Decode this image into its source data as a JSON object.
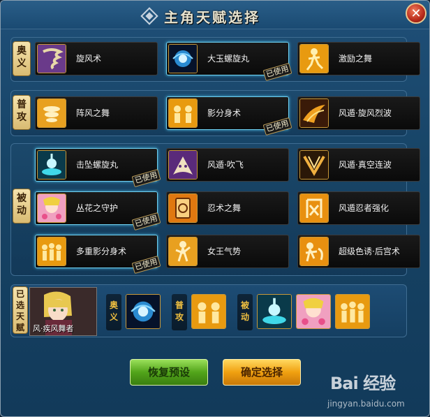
{
  "window": {
    "title": "主角天赋选择",
    "close_label": "✕"
  },
  "sections": {
    "ougi": {
      "tag": [
        "奥",
        "义"
      ],
      "skills": [
        {
          "name": "旋风术",
          "used": false,
          "icon": "tornado-icon"
        },
        {
          "name": "大玉螺旋丸",
          "used": true,
          "icon": "rasengan-icon"
        },
        {
          "name": "激励之舞",
          "used": false,
          "icon": "dance-icon"
        }
      ]
    },
    "attack": {
      "tag": [
        "普",
        "攻"
      ],
      "skills": [
        {
          "name": "阵风之舞",
          "used": false,
          "icon": "gust-icon"
        },
        {
          "name": "影分身术",
          "used": true,
          "icon": "shadow-clone-icon"
        },
        {
          "name": "风遁·旋风烈波",
          "used": false,
          "icon": "wind-wave-icon"
        }
      ]
    },
    "passive": {
      "tag": [
        "被",
        "动"
      ],
      "skills": [
        {
          "name": "击坠螺旋丸",
          "used": true,
          "icon": "rasengan-crash-icon"
        },
        {
          "name": "风遁·吹飞",
          "used": false,
          "icon": "fan-icon"
        },
        {
          "name": "风遁·真空连波",
          "used": false,
          "icon": "vacuum-icon"
        },
        {
          "name": "丛花之守护",
          "used": true,
          "icon": "flower-guard-icon"
        },
        {
          "name": "忍术之舞",
          "used": false,
          "icon": "ninjutsu-scroll-icon"
        },
        {
          "name": "风遁忍者强化",
          "used": false,
          "icon": "wind-kanji-icon"
        },
        {
          "name": "多重影分身术",
          "used": true,
          "icon": "multi-clone-icon"
        },
        {
          "name": "女王气势",
          "used": false,
          "icon": "queen-icon"
        },
        {
          "name": "超级色诱·后宫术",
          "used": false,
          "icon": "harem-icon"
        }
      ]
    }
  },
  "used_label": "已使用",
  "selected": {
    "tag": [
      "已",
      "选",
      "天",
      "赋"
    ],
    "character_name": "风·疾风舞者",
    "groups": [
      {
        "tag": [
          "奥",
          "义"
        ]
      },
      {
        "tag": [
          "普",
          "攻"
        ]
      },
      {
        "tag": [
          "被",
          "动"
        ]
      }
    ]
  },
  "buttons": {
    "reset": "恢复预设",
    "confirm": "确定选择"
  },
  "watermark": {
    "main": "Bai 经验",
    "sub": "jingyan.baidu.com"
  },
  "colors": {
    "panel_blue": "#174466",
    "gold_accent": "#d9bb72",
    "active_glow": "#6fd0f0",
    "reset_green": "#52a41a",
    "confirm_orange": "#f0a010"
  }
}
